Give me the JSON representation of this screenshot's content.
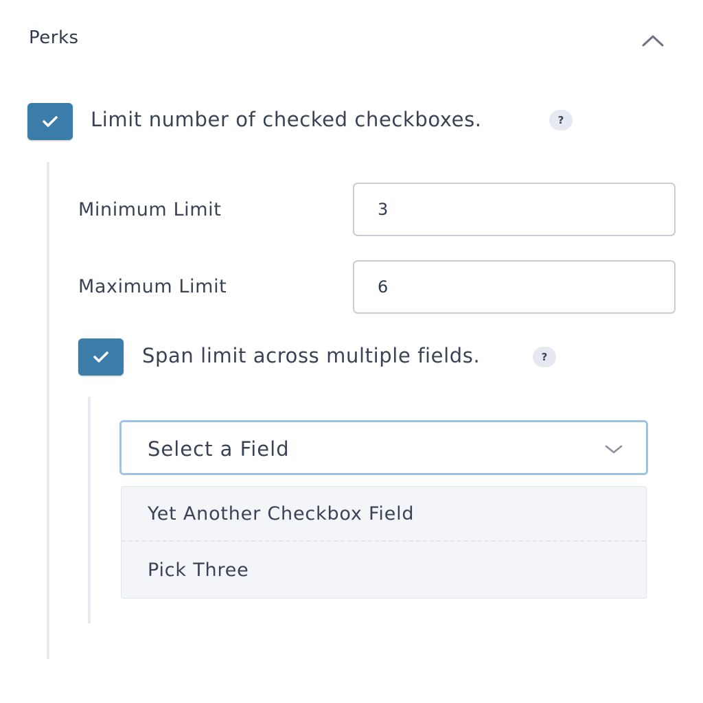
{
  "section": {
    "title": "Perks",
    "collapse_icon": "chevron-up-icon"
  },
  "limit_checkbox": {
    "checked": true,
    "label": "Limit number of checked checkboxes.",
    "help": "?"
  },
  "fields": {
    "minimum": {
      "label": "Minimum Limit",
      "value": "3"
    },
    "maximum": {
      "label": "Maximum Limit",
      "value": "6"
    }
  },
  "span_checkbox": {
    "checked": true,
    "label": "Span limit across multiple fields.",
    "help": "?"
  },
  "select": {
    "value": "Select a Field",
    "icon": "chevron-down-icon",
    "options": [
      "Yet Another Checkbox Field",
      "Pick Three"
    ]
  },
  "colors": {
    "checkbox_fill": "#3b7da8",
    "select_focus_border": "#9cc3e6",
    "dropdown_bg": "#f3f5f9"
  }
}
